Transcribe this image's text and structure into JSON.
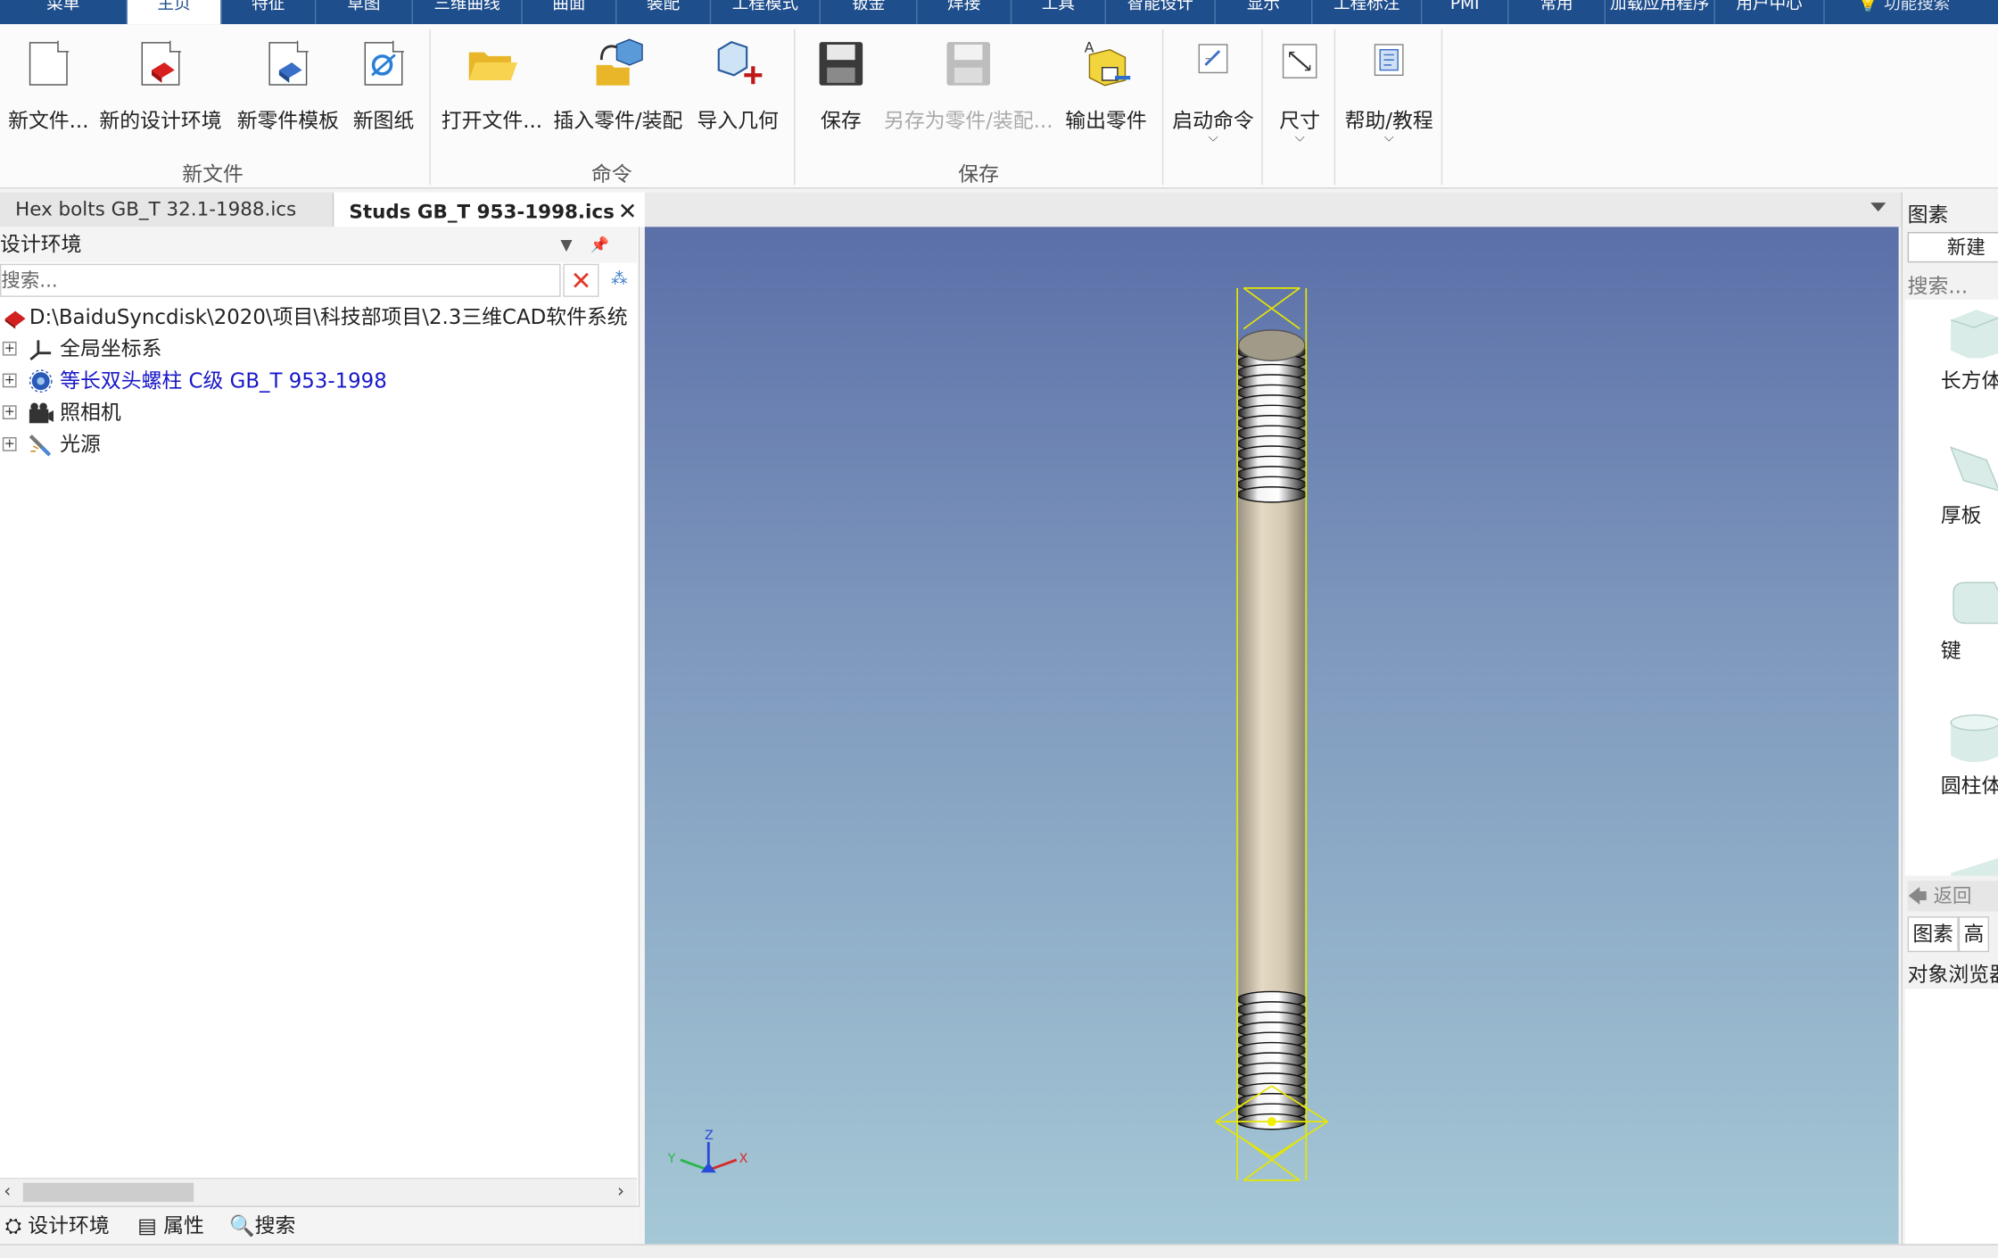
{
  "menu": {
    "tabs": [
      "菜单",
      "主页",
      "特征",
      "草图",
      "三维曲线",
      "曲面",
      "装配",
      "工程模式",
      "钣金",
      "焊接",
      "工具",
      "智能设计",
      "显示",
      "工程标注",
      "PMI",
      "常用",
      "加载应用程序",
      "用户中心"
    ],
    "active_index": 1,
    "search_label": "功能搜索"
  },
  "ribbon": {
    "buttons": {
      "new_file": "新文件...",
      "new_design_env": "新的设计环境",
      "new_part_template": "新零件模板",
      "new_drawing": "新图纸",
      "open_file": "打开文件...",
      "insert_part": "插入零件/装配",
      "import_geometry": "导入几何",
      "save": "保存",
      "save_as_part": "另存为零件/装配...",
      "export_part": "输出零件",
      "launch_command": "启动命令",
      "dimension": "尺寸",
      "help_tutorial": "帮助/教程"
    },
    "groups": {
      "new_file": "新文件",
      "command": "命令",
      "save": "保存"
    }
  },
  "documents": {
    "tabs": [
      "Hex bolts GB_T 32.1-1988.ics",
      "Studs GB_T 953-1998.ics"
    ],
    "active_index": 1,
    "close_glyph": "✕"
  },
  "design_env": {
    "title": "设计环境",
    "search_placeholder": "搜索...",
    "tree": {
      "root_path": "D:\\BaiduSyncdisk\\2020\\项目\\科技部项目\\2.3三维CAD软件系统",
      "items": [
        {
          "label": "全局坐标系"
        },
        {
          "label": "等长双头螺柱 C级 GB_T 953-1998"
        },
        {
          "label": "照相机"
        },
        {
          "label": "光源"
        }
      ]
    },
    "bottom_tabs": [
      "设计环境",
      "属性",
      "搜索"
    ]
  },
  "viewport": {
    "axis_labels": {
      "x": "X",
      "y": "Y",
      "z": "Z"
    }
  },
  "catalog": {
    "title": "图素",
    "new_label": "新建",
    "search_placeholder": "搜索...",
    "items": [
      "长方体",
      "厚板",
      "键",
      "圆柱体"
    ],
    "back_label": "返回",
    "tabs": [
      "图素",
      "高"
    ],
    "object_browser": "对象浏览器"
  },
  "colors": {
    "menu_bg": "#1f4e8c",
    "selection_outline": "#e6e600",
    "rod_fill": "#d8cdb4",
    "tree_link": "#1717c8"
  }
}
